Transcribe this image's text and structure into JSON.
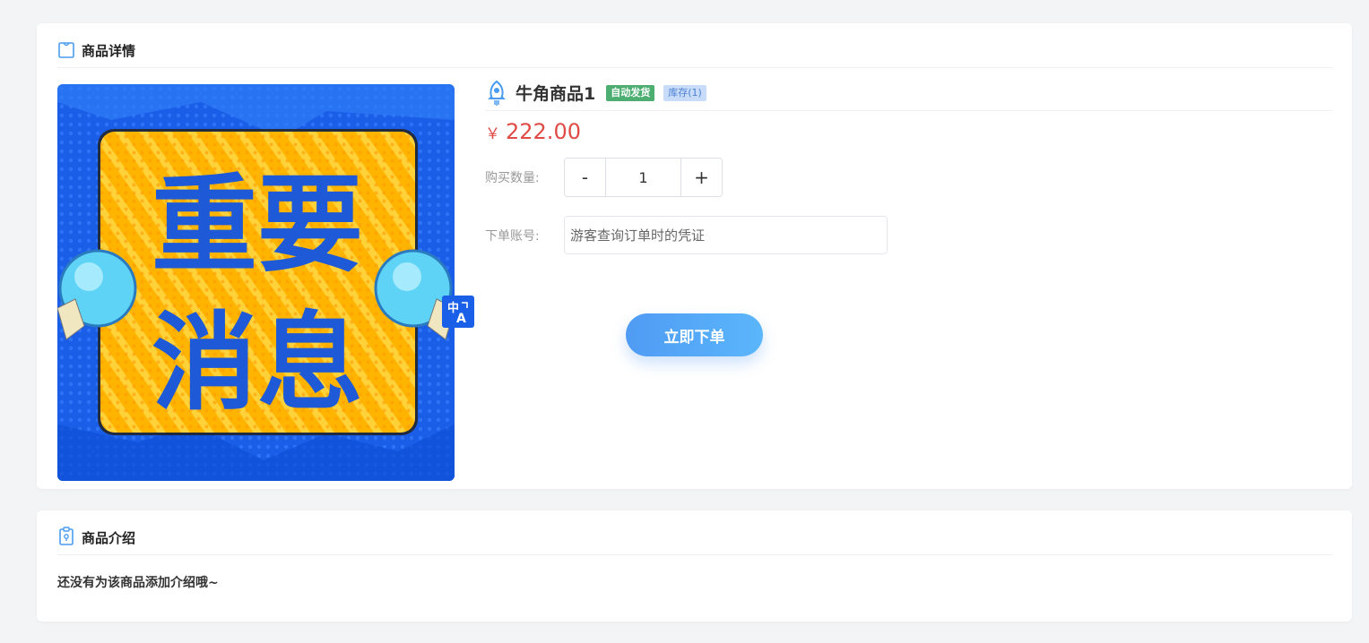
{
  "detail_section": {
    "title": "商品详情",
    "image": {
      "line1": "重要",
      "line2": "消息"
    }
  },
  "product": {
    "name": "牛角商品1",
    "tags": {
      "auto_delivery": "自动发货",
      "stock": "库存(1)"
    },
    "currency": "￥",
    "price": "222.00",
    "quantity_label": "购买数量:",
    "quantity_minus": "-",
    "quantity_value": "1",
    "quantity_plus": "+",
    "account_label": "下单账号:",
    "account_placeholder": "游客查询订单时的凭证",
    "order_button": "立即下单"
  },
  "translate_badge": {
    "glyph_top": "中",
    "glyph_bottom": "A"
  },
  "intro_section": {
    "title": "商品介绍",
    "text": "还没有为该商品添加介绍哦~"
  },
  "colors": {
    "accent": "#4f9bf4",
    "price": "#e04b46",
    "auto_tag": "#4cae70",
    "stock_tag": "#c8dcfa"
  },
  "icons": [
    "bag-icon",
    "rocket-icon",
    "clipboard-icon",
    "translate-icon"
  ]
}
